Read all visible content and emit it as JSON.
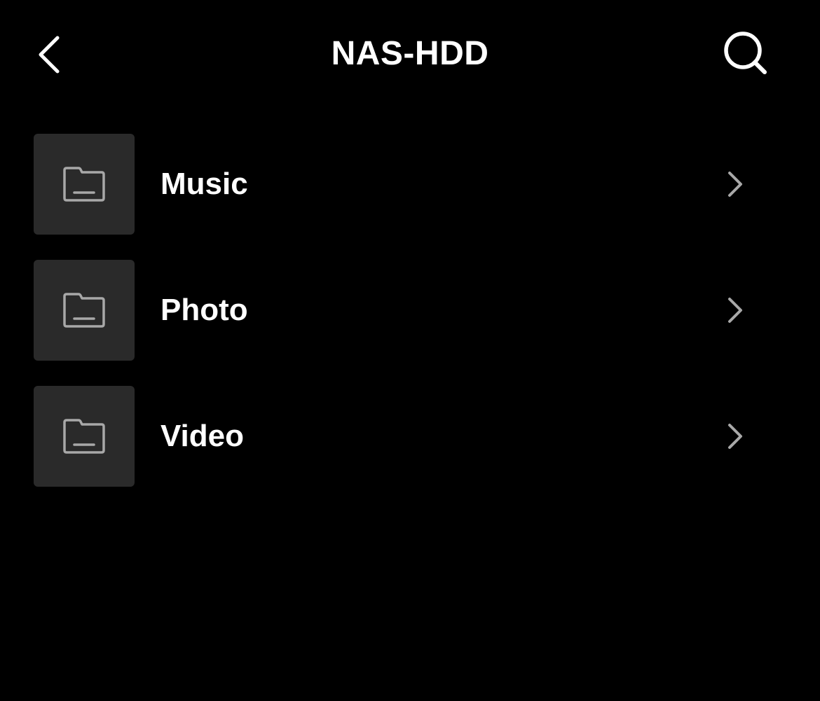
{
  "header": {
    "title": "NAS-HDD",
    "back_icon": "chevron-left-icon",
    "search_icon": "search-icon"
  },
  "folders": [
    {
      "label": "Music",
      "icon": "folder-icon"
    },
    {
      "label": "Photo",
      "icon": "folder-icon"
    },
    {
      "label": "Video",
      "icon": "folder-icon"
    }
  ],
  "colors": {
    "background": "#000000",
    "thumb_background": "#2a2a2a",
    "text": "#ffffff",
    "icon_gray": "#a8a8a8"
  }
}
